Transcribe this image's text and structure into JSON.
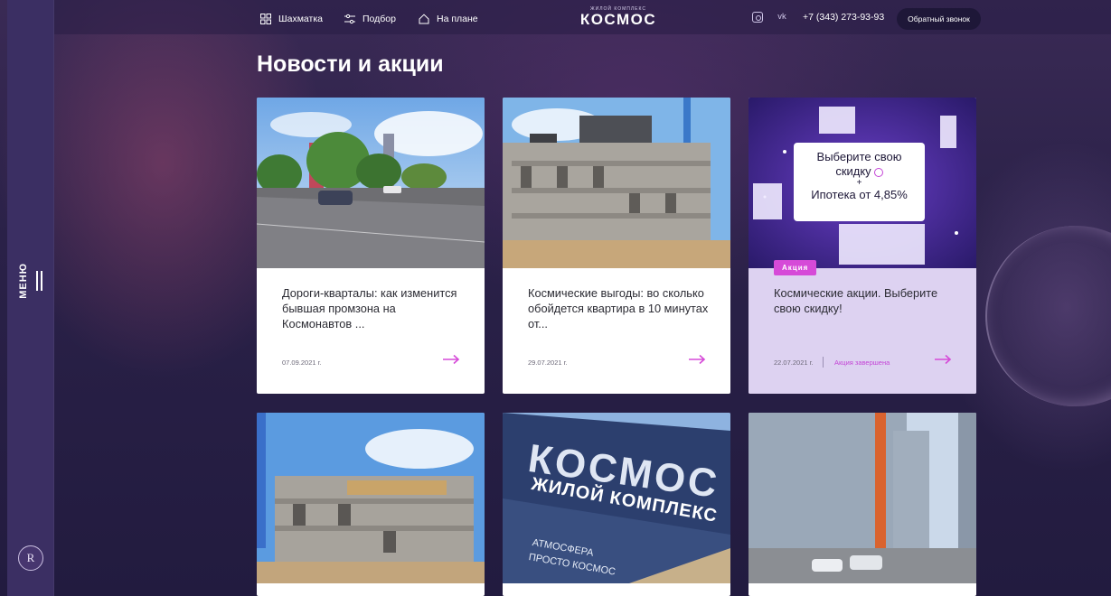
{
  "nav": {
    "items": [
      {
        "label": "Шахматка",
        "icon": "grid-icon"
      },
      {
        "label": "Подбор",
        "icon": "filter-icon"
      },
      {
        "label": "На плане",
        "icon": "home-icon"
      }
    ],
    "brand_sub": "ЖИЛОЙ КОМПЛЕКС",
    "brand_name": "КОСМОС",
    "social": [
      {
        "icon": "instagram-icon"
      },
      {
        "label": "vk",
        "icon": "vk-icon"
      }
    ],
    "phone": "+7 (343) 273-93-93",
    "callback_label": "Обратный звонок"
  },
  "rail": {
    "menu_label": "МЕНЮ",
    "logo_letter": "R"
  },
  "page": {
    "title": "Новости и акции"
  },
  "cards": [
    {
      "title": "Дороги-кварталы: как изменится бывшая промзона на Космонавтов ...",
      "date": "07.09.2021 г."
    },
    {
      "title": "Космические выгоды: во сколько обойдется квартира в 10 минутах от...",
      "date": "29.07.2021 г."
    },
    {
      "title": "Космические акции. Выберите свою скидку!",
      "date": "22.07.2021 г.",
      "badge": "Акция",
      "status": "Акция завершена",
      "panel": {
        "line1": "Выберите свою",
        "line2": "скидку",
        "plus": "+",
        "line3": "Ипотека от 4,85%"
      }
    }
  ],
  "bottom_cards": [
    {
      "image": "construction-photo"
    },
    {
      "image": "kosmos-sign-photo",
      "sign_line1": "КОСМОС",
      "sign_line2": "ЖИЛОЙ КОМПЛЕКС",
      "sign_line3": "АТМОСФЕРА",
      "sign_line4": "ПРОСТО КОСМОС"
    },
    {
      "image": "tower-photo"
    }
  ],
  "colors": {
    "accent": "#d64ad8",
    "rail": "#3b2f63",
    "card_bg": "#ffffff",
    "promo_bg": "#ddd2f1"
  }
}
